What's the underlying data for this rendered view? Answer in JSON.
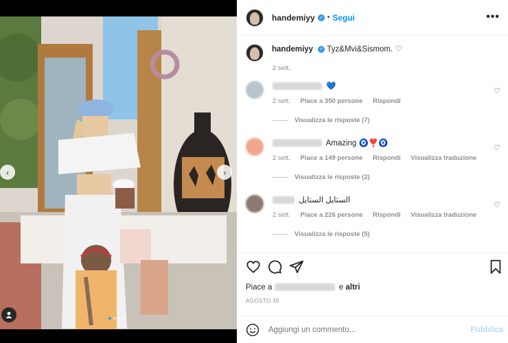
{
  "post": {
    "username": "handemiyy",
    "follow_label": "Segui",
    "separator": "•",
    "more_icon": "•••"
  },
  "caption": {
    "username": "handemiyy",
    "text": "Tyz&Mvi&Sismom. ♡",
    "time": "2 sett."
  },
  "comments": [
    {
      "text": "💙",
      "time": "2 sett.",
      "likes": "Piace a 350 persone",
      "reply": "Rispondi",
      "translate": "",
      "replies": "Visualizza le risposte (7)",
      "avatar_color": "#b9c4cc"
    },
    {
      "text": "Amazing 🧿❣️🧿",
      "time": "2 sett.",
      "likes": "Piace a 149 persone",
      "reply": "Rispondi",
      "translate": "Visualizza traduzione",
      "replies": "Visualizza le risposte (2)",
      "avatar_color": "#f0a58c"
    },
    {
      "text": "الستايل الستايل",
      "time": "2 sett.",
      "likes": "Piace a 226 persone",
      "reply": "Rispondi",
      "translate": "Visualizza traduzione",
      "replies": "Visualizza le risposte (5)",
      "avatar_color": "#8a7a70"
    }
  ],
  "likes": {
    "prefix": "Piace a",
    "middle": "e",
    "others": "altri"
  },
  "date": "AGOSTO 30",
  "add_comment": {
    "placeholder": "Aggiungi un commento...",
    "publish_label": "Pubblica"
  },
  "colors": {
    "accent": "#0095f6",
    "verified": "#3897f0"
  },
  "carousel": {
    "slides": 4,
    "active": 0
  }
}
